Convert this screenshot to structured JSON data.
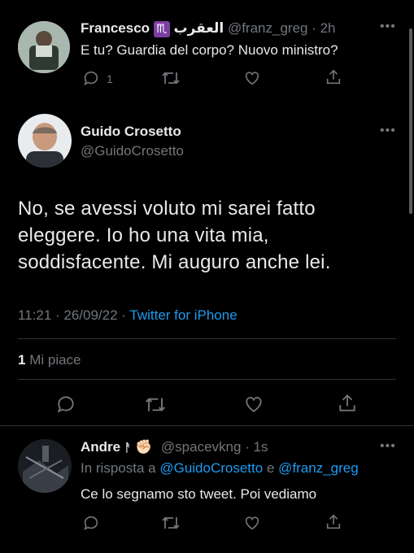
{
  "tweet1": {
    "name": "Francesco",
    "emoji": "♏",
    "arabic": "العقرب",
    "handle": "@franz_greg",
    "time": "· 2h",
    "text": "E tu? Guardia del corpo? Nuovo ministro?",
    "reply_count": "1"
  },
  "main_tweet": {
    "name": "Guido Crosetto",
    "handle": "@GuidoCrosetto",
    "text_lines": [
      "No, se avessi voluto mi sarei fatto",
      "eleggere. Io ho una vita mia,",
      "soddisfacente. Mi auguro anche lei."
    ],
    "time": "11:21 · 26/09/22 ·",
    "source": "Twitter for iPhone",
    "likes_count": "1",
    "likes_label": "Mi piace"
  },
  "reply": {
    "name": "Andre",
    "name_symbol": "ᚨ",
    "emoji": "✊🏻",
    "handle": "@spacevkng",
    "time": "· 1s",
    "in_reply_prefix": "In risposta a",
    "mention1": "@GuidoCrosetto",
    "conj": "e",
    "mention2": "@franz_greg",
    "text": "Ce lo segnamo sto tweet. Poi vediamo"
  },
  "icons": [
    "reply-icon",
    "retweet-icon",
    "like-icon",
    "share-icon",
    "more-icon"
  ],
  "colors": {
    "background": "#000000",
    "text": "#e7e9ea",
    "muted": "#71767b",
    "link": "#1d9bf0",
    "divider": "#2f3336"
  }
}
